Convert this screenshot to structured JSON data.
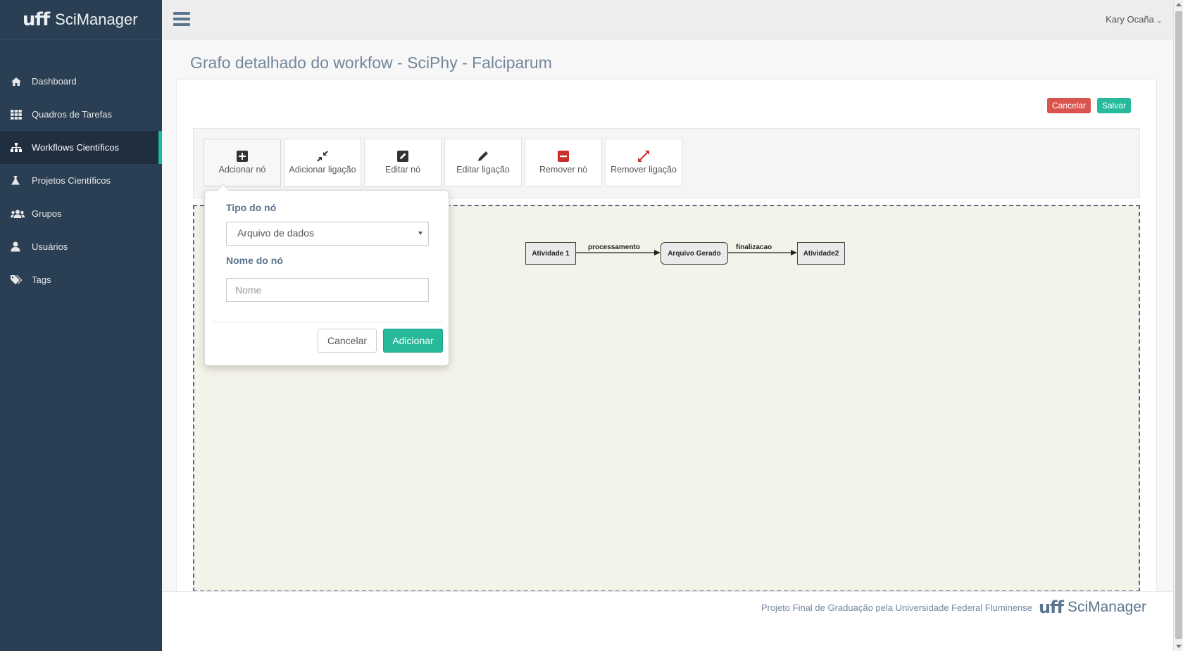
{
  "app": {
    "logo": "uff",
    "name": "SciManager"
  },
  "sidebar": {
    "items": [
      {
        "label": "Dashboard",
        "icon": "home-icon"
      },
      {
        "label": "Quadros de Tarefas",
        "icon": "grid-icon"
      },
      {
        "label": "Workflows Científicos",
        "icon": "sitemap-icon"
      },
      {
        "label": "Projetos Científicos",
        "icon": "flask-icon"
      },
      {
        "label": "Grupos",
        "icon": "users-icon"
      },
      {
        "label": "Usuários",
        "icon": "user-icon"
      },
      {
        "label": "Tags",
        "icon": "tags-icon"
      }
    ],
    "active": "Workflows Científicos"
  },
  "topnav": {
    "user": "Kary Ocaña"
  },
  "page": {
    "title": "Grafo detalhado do workfow - SciPhy - Falciparum"
  },
  "actions": {
    "cancel": "Cancelar",
    "save": "Salvar"
  },
  "toolbar": {
    "add_node": "Adcionar nó",
    "add_link": "Adicionar ligação",
    "edit_node": "Editar nó",
    "edit_link": "Editar ligação",
    "remove_node": "Remover nó",
    "remove_link": "Remover ligação"
  },
  "graph": {
    "nodes": [
      "Atividade 1",
      "Arquivo Gerado",
      "Atividade2"
    ],
    "edges": [
      "processamento",
      "finalizacao"
    ]
  },
  "popover": {
    "type_label": "Tipo do nó",
    "type_value": "Arquivo de dados",
    "name_label": "Nome do nó",
    "name_placeholder": "Nome",
    "cancel": "Cancelar",
    "add": "Adicionar"
  },
  "footer": {
    "text": "Projeto Final de Graduação pela Universidade Federal Fluminense",
    "logo": "uff",
    "name": "SciManager"
  },
  "colors": {
    "sidebar": "#2a3f54",
    "accent": "#1abb9c",
    "danger": "#d9534f",
    "success": "#26b99a",
    "canvas": "#f4f3e9"
  }
}
